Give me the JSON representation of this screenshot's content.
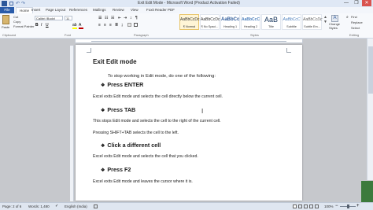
{
  "window": {
    "title": "Exit Edit Mode - Microsoft Word (Product Activation Failed)",
    "minimize": "—",
    "restore": "❐",
    "close": "✕"
  },
  "tabs": [
    {
      "label": "File"
    },
    {
      "label": "Home"
    },
    {
      "label": "Insert"
    },
    {
      "label": "Page Layout"
    },
    {
      "label": "References"
    },
    {
      "label": "Mailings"
    },
    {
      "label": "Review"
    },
    {
      "label": "View"
    },
    {
      "label": "Foxit Reader PDF"
    }
  ],
  "ribbon": {
    "clipboard": {
      "paste_label": "Paste",
      "cut_label": "Cut",
      "copy_label": "Copy",
      "format_painter_label": "Format Painter",
      "group_label": "Clipboard"
    },
    "font": {
      "font_name": "Calibri (Body)",
      "font_size": "11",
      "group_label": "Font"
    },
    "paragraph": {
      "group_label": "Paragraph"
    },
    "styles": {
      "group_label": "Styles",
      "items": [
        {
          "preview": "AaBbCcDc",
          "name": "¶ Normal"
        },
        {
          "preview": "AaBbCcDc",
          "name": "¶ No Spaci..."
        },
        {
          "preview": "AaBbCc",
          "name": "Heading 1"
        },
        {
          "preview": "AaBbCcC",
          "name": "Heading 2"
        },
        {
          "preview": "AaB",
          "name": "Title"
        },
        {
          "preview": "AaBbCcC",
          "name": "Subtitle"
        },
        {
          "preview": "AaBbCcDc",
          "name": "Subtle Em..."
        }
      ],
      "change_styles_label": "Change Styles"
    },
    "editing": {
      "find_label": "Find",
      "replace_label": "Replace",
      "select_label": "Select",
      "group_label": "Editing"
    }
  },
  "document": {
    "heading": "Exit Edit mode",
    "intro": "To stop working in Edit mode, do one of the following:",
    "sections": [
      {
        "title": "Press ENTER",
        "lines": [
          "Excel exits Edit mode and selects the cell directly below the current cell."
        ]
      },
      {
        "title": "Press TAB",
        "lines": [
          "This stops Edit mode and selects the cell to the right of the current cell.",
          "Pressing SHIFT+TAB selects the cell to the left."
        ]
      },
      {
        "title": "Click a different cell",
        "lines": [
          "Excel exits Edit mode and selects the cell that you clicked."
        ]
      },
      {
        "title": "Press F2",
        "lines": [
          "Excel exits Edit mode and leaves the cursor where it is."
        ]
      }
    ]
  },
  "status": {
    "page": "Page: 2 of 6",
    "words": "Words: 1,480",
    "language": "English (India)",
    "zoom": "100%",
    "zoom_level_fraction": 0.5
  }
}
